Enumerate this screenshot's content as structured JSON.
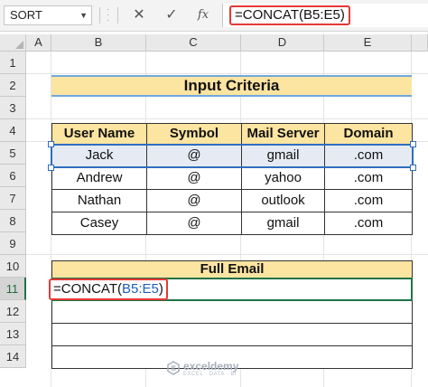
{
  "formula_bar": {
    "name_box": "SORT",
    "cancel_icon": "✕",
    "enter_icon": "✓",
    "fx_label": "fx",
    "formula": "=CONCAT(B5:E5)"
  },
  "columns": [
    "A",
    "B",
    "C",
    "D",
    "E"
  ],
  "rows": [
    "1",
    "2",
    "3",
    "4",
    "5",
    "6",
    "7",
    "8",
    "9",
    "10",
    "11",
    "12",
    "13",
    "14"
  ],
  "title": "Input Criteria",
  "table": {
    "headers": [
      "User Name",
      "Symbol",
      "Mail Server",
      "Domain"
    ],
    "data": [
      [
        "Jack",
        "@",
        "gmail",
        ".com"
      ],
      [
        "Andrew",
        "@",
        "yahoo",
        ".com"
      ],
      [
        "Nathan",
        "@",
        "outlook",
        ".com"
      ],
      [
        "Casey",
        "@",
        "gmail",
        ".com"
      ]
    ]
  },
  "email": {
    "header": "Full Email",
    "formula_prefix": "=CONCAT(",
    "formula_ref": "B5:E5",
    "formula_suffix": ")"
  },
  "watermark": {
    "name": "exceldemy",
    "tagline": "EXCEL · DATA · BI"
  },
  "colors": {
    "header_fill": "#fce4a1",
    "selection_blue": "#2f6dbf",
    "active_green": "#217346",
    "highlight_red": "#e53935"
  }
}
